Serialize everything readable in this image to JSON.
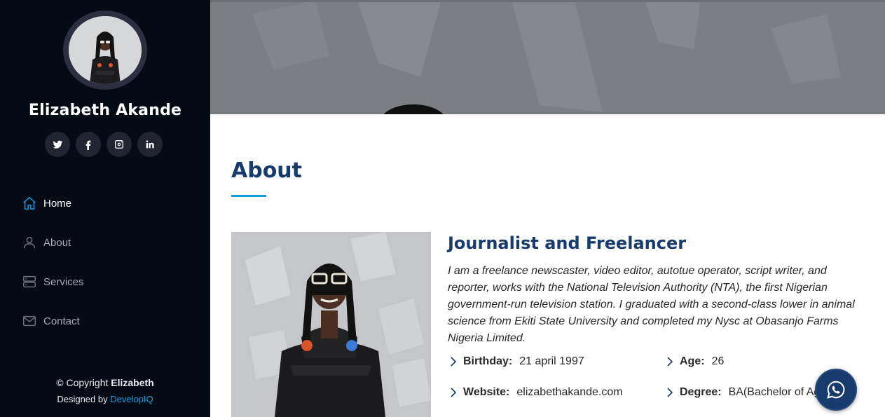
{
  "profile": {
    "name": "Elizabeth Akande",
    "social": [
      "twitter-icon",
      "facebook-icon",
      "instagram-icon",
      "linkedin-icon"
    ]
  },
  "nav": {
    "items": [
      {
        "label": "Home",
        "icon": "home-icon",
        "active": true
      },
      {
        "label": "About",
        "icon": "person-icon",
        "active": false
      },
      {
        "label": "Services",
        "icon": "server-icon",
        "active": false
      },
      {
        "label": "Contact",
        "icon": "envelope-icon",
        "active": false
      }
    ]
  },
  "footer": {
    "copyright_prefix": "© Copyright",
    "copyright_name": "Elizabeth",
    "designed_prefix": "Designed by",
    "designed_by": "DevelopIQ"
  },
  "about": {
    "title": "About",
    "heading": "Journalist and Freelancer",
    "description": "I am a freelance newscaster, video editor, autotue operator, script writer, and reporter, works with the National Television Authority (NTA), the first Nigerian government-run television station. I graduated with a second-class lower in animal science from Ekiti State University and completed my Nysc at Obasanjo Farms Nigeria Limited.",
    "facts": [
      {
        "key": "Birthday:",
        "value": "21 april 1997"
      },
      {
        "key": "Age:",
        "value": "26"
      },
      {
        "key": "Website:",
        "value": "elizabethakande.com"
      },
      {
        "key": "Degree:",
        "value": "BA(Bachelor of Ag"
      }
    ]
  },
  "colors": {
    "sidebar_bg": "#040b14",
    "accent": "#149ddd",
    "heading": "#173b6c"
  },
  "floating": {
    "icon": "whatsapp-icon"
  }
}
